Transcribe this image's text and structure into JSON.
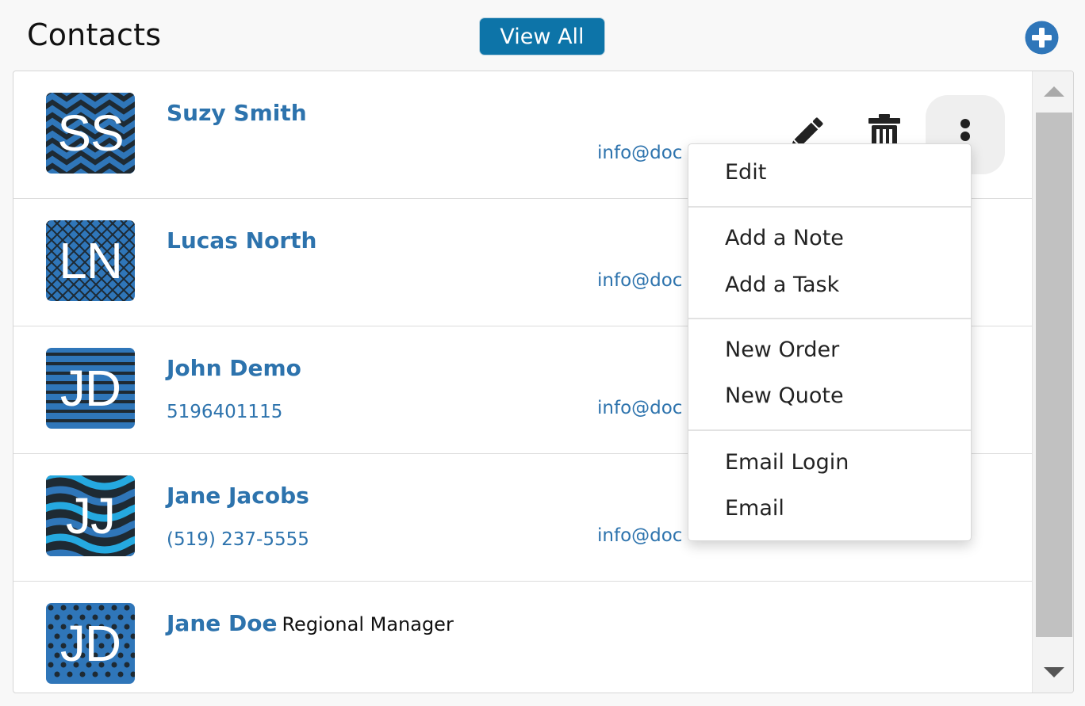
{
  "header": {
    "title": "Contacts",
    "view_all_label": "View All",
    "add_icon": "plus-circle-icon"
  },
  "contacts": [
    {
      "initials": "SS",
      "pattern": "chevron",
      "name": "Suzy Smith",
      "role": "",
      "phone": "",
      "email": "info@doc"
    },
    {
      "initials": "LN",
      "pattern": "crosshatch",
      "name": "Lucas North",
      "role": "",
      "phone": "",
      "email": "info@doc"
    },
    {
      "initials": "JD",
      "pattern": "stripes",
      "name": "John Demo",
      "role": "",
      "phone": "5196401115",
      "email": "info@doc"
    },
    {
      "initials": "JJ",
      "pattern": "waves",
      "name": "Jane Jacobs",
      "role": "",
      "phone": "(519) 237-5555",
      "email": "info@doc"
    },
    {
      "initials": "JD",
      "pattern": "dots",
      "name": "Jane Doe",
      "role": "Regional Manager",
      "phone": "",
      "email": ""
    }
  ],
  "row_actions": {
    "edit_icon": "pencil-icon",
    "delete_icon": "trash-icon",
    "more_icon": "more-vertical-icon"
  },
  "menu": {
    "groups": [
      [
        "Edit"
      ],
      [
        "Add a Note",
        "Add a Task"
      ],
      [
        "New Order",
        "New Quote"
      ],
      [
        "Email Login",
        "Email"
      ]
    ]
  },
  "colors": {
    "accent": "#0d74a8",
    "link": "#2d73ad",
    "avatar_blue": "#2f76b9",
    "avatar_dark": "#1e2a33",
    "avatar_cyan": "#25a9e0"
  }
}
